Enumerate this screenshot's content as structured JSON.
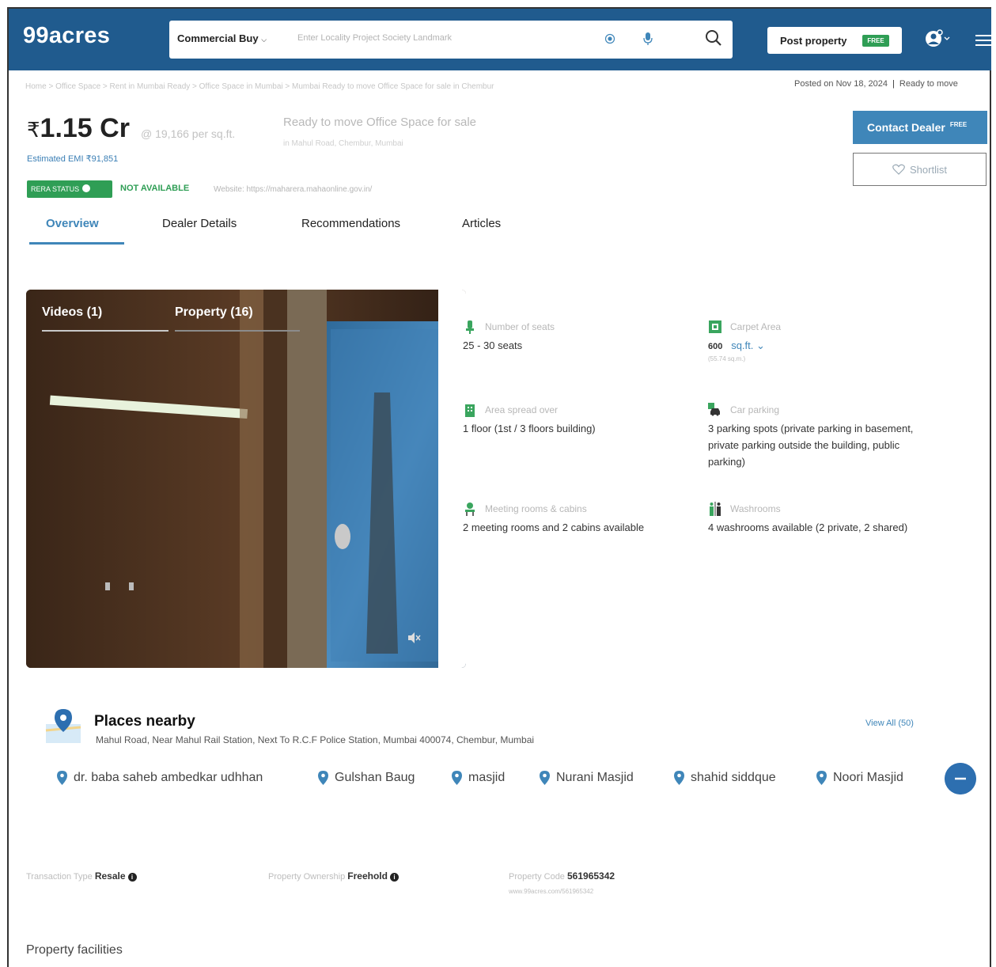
{
  "header": {
    "logo": "99acres",
    "search_type": "Commercial Buy",
    "search_placeholder": "Enter Locality  Project  Society  Landmark",
    "post_property": "Post property",
    "post_free_tag": "FREE"
  },
  "breadcrumb": {
    "text": "Home > Office Space > Rent in Mumbai Ready > Office Space in Mumbai > Mumbai Ready to move Office Space for sale in Chembur",
    "posted": "Posted on Nov 18, 2024",
    "status": "Ready to move"
  },
  "listing": {
    "rupee": "₹",
    "price": "1.15 Cr",
    "per_sqft": "@ 19,166 per sq.ft.",
    "emi": "Estimated EMI ₹91,851",
    "title": "Ready to move Office Space for sale",
    "subtitle": "in Mahul Road, Chembur, Mumbai",
    "rera_status": "RERA STATUS",
    "rera_value": "NOT AVAILABLE",
    "rera_website": "Website: https://maharera.mahaonline.gov.in/",
    "contact_label": "Contact Dealer",
    "contact_free": "FREE",
    "shortlist_label": "Shortlist"
  },
  "tabs": [
    {
      "label": "Overview",
      "active": true
    },
    {
      "label": "Dealer Details",
      "active": false
    },
    {
      "label": "Recommendations",
      "active": false
    },
    {
      "label": "Articles",
      "active": false
    }
  ],
  "media": {
    "tabs": [
      "Videos (1)",
      "Property (16)"
    ]
  },
  "specs": {
    "seats": {
      "label": "Number of seats",
      "value": "25 - 30 seats",
      "icon": "seat-icon"
    },
    "carpet": {
      "label": "Carpet Area",
      "value": "600",
      "unit": "sq.ft.",
      "sub": "(55.74 sq.m.)",
      "icon": "carpet-area-icon"
    },
    "floors": {
      "label": "Area spread over",
      "value": "1 floor (1st / 3 floors building)",
      "icon": "building-icon"
    },
    "parking": {
      "label": "Car parking",
      "value": "3 parking spots (private parking in basement, private parking outside the building, public parking)",
      "icon": "car-icon"
    },
    "meeting": {
      "label": "Meeting rooms & cabins",
      "value": "2 meeting rooms and 2 cabins available",
      "icon": "meeting-icon"
    },
    "washrooms": {
      "label": "Washrooms",
      "value": "4 washrooms available (2 private, 2 shared)",
      "icon": "washroom-icon"
    }
  },
  "places": {
    "title": "Places nearby",
    "address": "Mahul Road, Near Mahul Rail Station, Next To R.C.F Police Station, Mumbai 400074, Chembur, Mumbai",
    "view_all": "View All (50)",
    "items": [
      "dr. baba saheb ambedkar udhhan",
      "Gulshan Baug",
      "masjid",
      "Nurani Masjid",
      "shahid siddque",
      "Noori Masjid"
    ]
  },
  "property_info": {
    "transaction_label": "Transaction Type",
    "transaction_value": "Resale",
    "ownership_label": "Property Ownership",
    "ownership_value": "Freehold",
    "code_label": "Property Code",
    "code_value": "561965342",
    "code_url": "www.99acres.com/561965342"
  },
  "facilities_title": "Property facilities",
  "colors": {
    "header_bg": "#205b8e",
    "accent": "#3f86b9",
    "green": "#2f9e55"
  }
}
